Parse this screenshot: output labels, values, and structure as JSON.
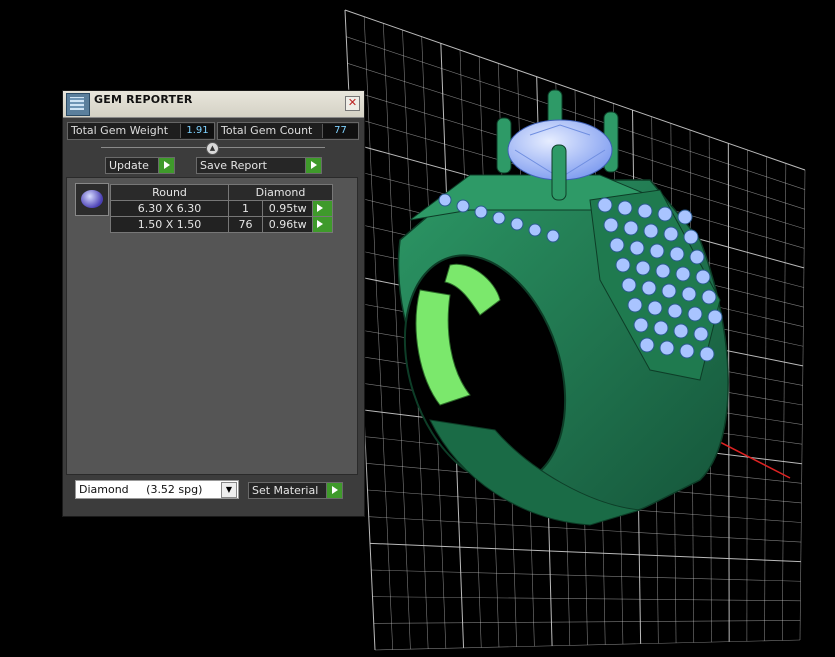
{
  "panel": {
    "title": "GEM REPORTER",
    "total_gem_weight_label": "Total Gem Weight",
    "total_gem_weight_value": "1.91",
    "total_gem_count_label": "Total Gem Count",
    "total_gem_count_value": "77",
    "update_label": "Update",
    "save_report_label": "Save Report",
    "table": {
      "headers": [
        "Round",
        "Diamond"
      ],
      "rows": [
        {
          "size": "6.30 X 6.30",
          "count": "1",
          "weight": "0.95tw"
        },
        {
          "size": "1.50 X 1.50",
          "count": "76",
          "weight": "0.96tw"
        }
      ]
    },
    "material_value": "Diamond     (3.52 spg)",
    "set_material_label": "Set Material"
  },
  "colors": {
    "ring_green": "#1f7a4f",
    "gem_blue": "#a9c4ff",
    "highlight_green": "#7be86c",
    "grid": "#cfcfcf",
    "button_green": "#3f9a2b"
  }
}
